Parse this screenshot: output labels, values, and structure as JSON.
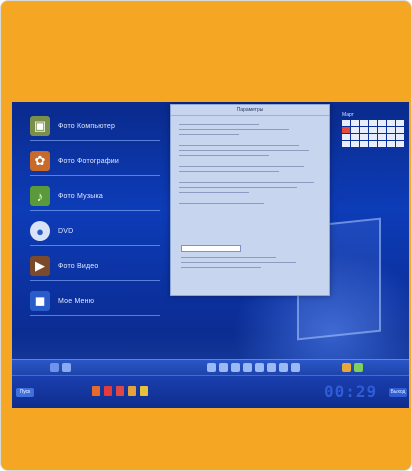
{
  "desktop": {
    "menu_items": [
      {
        "label": "Фото Компьютер",
        "icon": "computer-icon",
        "color": "#7a8f4a",
        "glyph": "▣"
      },
      {
        "label": "Фото Фотографии",
        "icon": "photos-icon",
        "color": "#c76a2a",
        "glyph": "✿"
      },
      {
        "label": "Фото Музыка",
        "icon": "music-icon",
        "color": "#5a9a3a",
        "glyph": "♪"
      },
      {
        "label": "DVD",
        "icon": "dvd-icon",
        "color": "#d9e3f5",
        "glyph": "●"
      },
      {
        "label": "Фото Видео",
        "icon": "video-icon",
        "color": "#7a4a2a",
        "glyph": "▶"
      },
      {
        "label": "Мое Меню",
        "icon": "window-icon",
        "color": "#2a5cc9",
        "glyph": "◼"
      }
    ],
    "dialog_title": "Параметры",
    "calendar_title": "Март",
    "calendar_highlight_index": 7
  },
  "taskbar": {
    "start_label": "Пуск",
    "clock": "00:29",
    "end_label": "Выход",
    "task_icon_colors": [
      "#e66b2a",
      "#e63b3b",
      "#e04848",
      "#e6a23a",
      "#e6c23a"
    ]
  },
  "strip": {
    "left_icon_colors": [
      "#6f93e8",
      "#88aaf0"
    ],
    "middle_icon_colors": [
      "#9bb9f5",
      "#9bb9f5",
      "#9bb9f5",
      "#9bb9f5",
      "#9bb9f5",
      "#9bb9f5",
      "#9bb9f5",
      "#9bb9f5"
    ],
    "right_icon_colors": [
      "#e6a83a",
      "#7fd05a"
    ]
  },
  "colors": {
    "frame": "#f5a623",
    "screen_top": "#0a2a8c",
    "clock": "#2f5cd8"
  }
}
